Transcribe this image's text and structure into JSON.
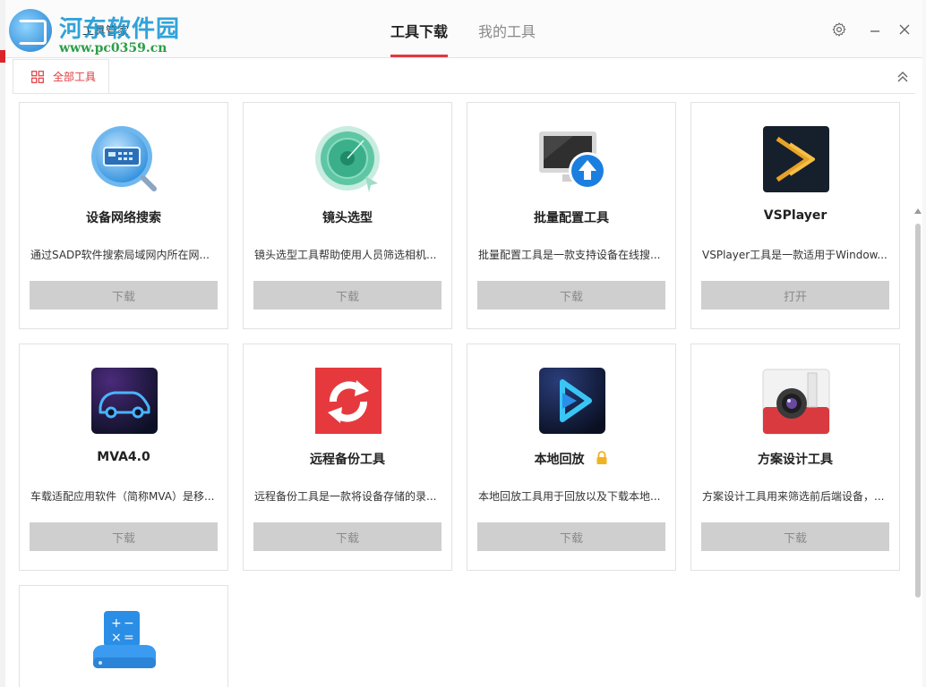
{
  "watermark": {
    "title": "河东软件园",
    "url": "www.pc0359.cn"
  },
  "app_title": "工具管家",
  "top_tabs": [
    {
      "label": "工具下载",
      "active": true
    },
    {
      "label": "我的工具",
      "active": false
    }
  ],
  "category_tab": {
    "label": "全部工具",
    "icon": "grid-icon"
  },
  "tools": [
    {
      "name": "设备网络搜索",
      "desc": "通过SADP软件搜索局域网内所在网...",
      "button": "下载",
      "icon": "device-search-icon"
    },
    {
      "name": "镜头选型",
      "desc": "镜头选型工具帮助使用人员筛选相机...",
      "button": "下载",
      "icon": "lens-icon"
    },
    {
      "name": "批量配置工具",
      "desc": "批量配置工具是一款支持设备在线搜...",
      "button": "下载",
      "icon": "monitor-upload-icon"
    },
    {
      "name": "VSPlayer",
      "desc": "VSPlayer工具是一款适用于Window...",
      "button": "打开",
      "icon": "vsplayer-icon"
    },
    {
      "name": "MVA4.0",
      "desc": "车载适配应用软件（简称MVA）是移...",
      "button": "下载",
      "icon": "car-icon"
    },
    {
      "name": "远程备份工具",
      "desc": "远程备份工具是一款将设备存储的录...",
      "button": "下载",
      "icon": "sync-icon"
    },
    {
      "name": "本地回放",
      "desc": "本地回放工具用于回放以及下载本地...",
      "button": "下载",
      "icon": "play-icon",
      "locked": true
    },
    {
      "name": "方案设计工具",
      "desc": "方案设计工具用来筛选前后端设备，...",
      "button": "下载",
      "icon": "camera-design-icon"
    },
    {
      "name": "",
      "desc": "",
      "button": "",
      "icon": "calculator-storage-icon"
    }
  ],
  "colors": {
    "accent": "#e0393e",
    "button_bg": "#cfcfcf",
    "border": "#e2e2e2"
  }
}
